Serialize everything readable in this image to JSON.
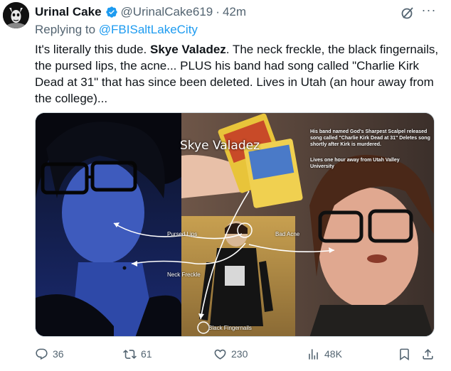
{
  "author": {
    "display_name": "Urinal Cake",
    "handle": "@UrinalCake619",
    "separator": "·",
    "time": "42m",
    "verified": true
  },
  "reply": {
    "prefix": "Replying to ",
    "target": "@FBISaltLakeCity"
  },
  "body": {
    "part1": "It's literally this dude. ",
    "bold_name": "Skye Valadez",
    "part2": ". The neck freckle, the black fingernails, the pursed lips, the acne... PLUS his band had song called \"Charlie Kirk Dead at 31\" that has since been deleted. Lives in Utah (an hour away from the college)..."
  },
  "media": {
    "name_overlay": "Skye Valadez",
    "band_note": "His band named God's Sharpest Scalpel released song called \"Charlie Kirk Dead at 31\" Deletes song shortly after Kirk is murdered.",
    "utah_note": "Lives one hour away from Utah Valley University",
    "labels": {
      "pursed_lips": "Pursed Lips",
      "bad_acne": "Bad Acne",
      "neck_freckle": "Neck Freckle",
      "black_fingernails": "Black Fingernails"
    }
  },
  "actions": {
    "replies": "36",
    "retweets": "61",
    "likes": "230",
    "views": "48K"
  },
  "colors": {
    "link": "#1d9bf0",
    "secondary_text": "#536471",
    "primary_text": "#0f1419",
    "border": "#cfd9de"
  },
  "icons": [
    "avatar-icon",
    "verified-icon",
    "grok-icon",
    "more-icon",
    "reply-icon",
    "retweet-icon",
    "like-icon",
    "views-icon",
    "bookmark-icon",
    "share-icon"
  ]
}
